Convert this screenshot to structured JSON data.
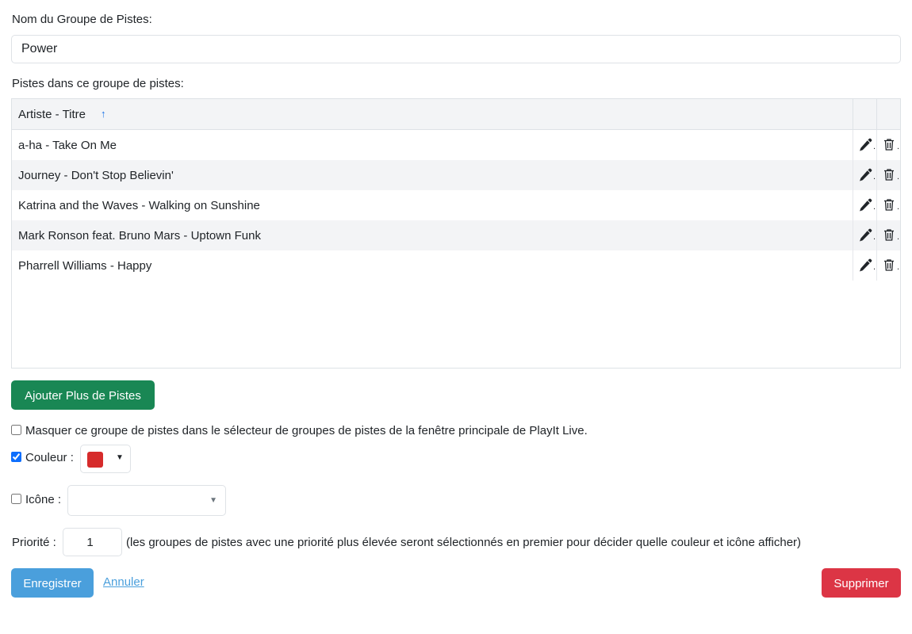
{
  "form": {
    "name_label": "Nom du Groupe de Pistes:",
    "name_value": "Power",
    "tracks_label": "Pistes dans ce groupe de pistes:"
  },
  "table": {
    "header": "Artiste - Titre",
    "sort_icon": "arrow-up-icon",
    "sort_glyph": "↑",
    "truncation": "..",
    "rows": [
      {
        "label": "a-ha - Take On Me"
      },
      {
        "label": "Journey - Don't Stop Believin'"
      },
      {
        "label": "Katrina and the Waves - Walking on Sunshine"
      },
      {
        "label": "Mark Ronson feat. Bruno Mars - Uptown Funk"
      },
      {
        "label": "Pharrell Williams - Happy"
      }
    ]
  },
  "add_button": "Ajouter Plus de Pistes",
  "options": {
    "hide_label": "Masquer ce groupe de pistes dans le sélecteur de groupes de pistes de la fenêtre principale de PlayIt Live.",
    "hide_checked": false,
    "color_label": "Couleur :",
    "color_checked": true,
    "color_value": "#d62b2b",
    "icon_label": "Icône :",
    "icon_checked": false,
    "icon_value": "",
    "dropdown_glyph": "▼",
    "priority_label": "Priorité :",
    "priority_value": "1",
    "priority_hint": "(les groupes de pistes avec une priorité plus élevée seront sélectionnés en premier pour décider quelle couleur et icône afficher)"
  },
  "actions": {
    "save": "Enregistrer",
    "cancel": "Annuler",
    "delete": "Supprimer"
  },
  "colors": {
    "add_button": "#198754",
    "save_button": "#4a9fdc",
    "delete_button": "#dc3545",
    "sort_arrow": "#1a73e8"
  }
}
